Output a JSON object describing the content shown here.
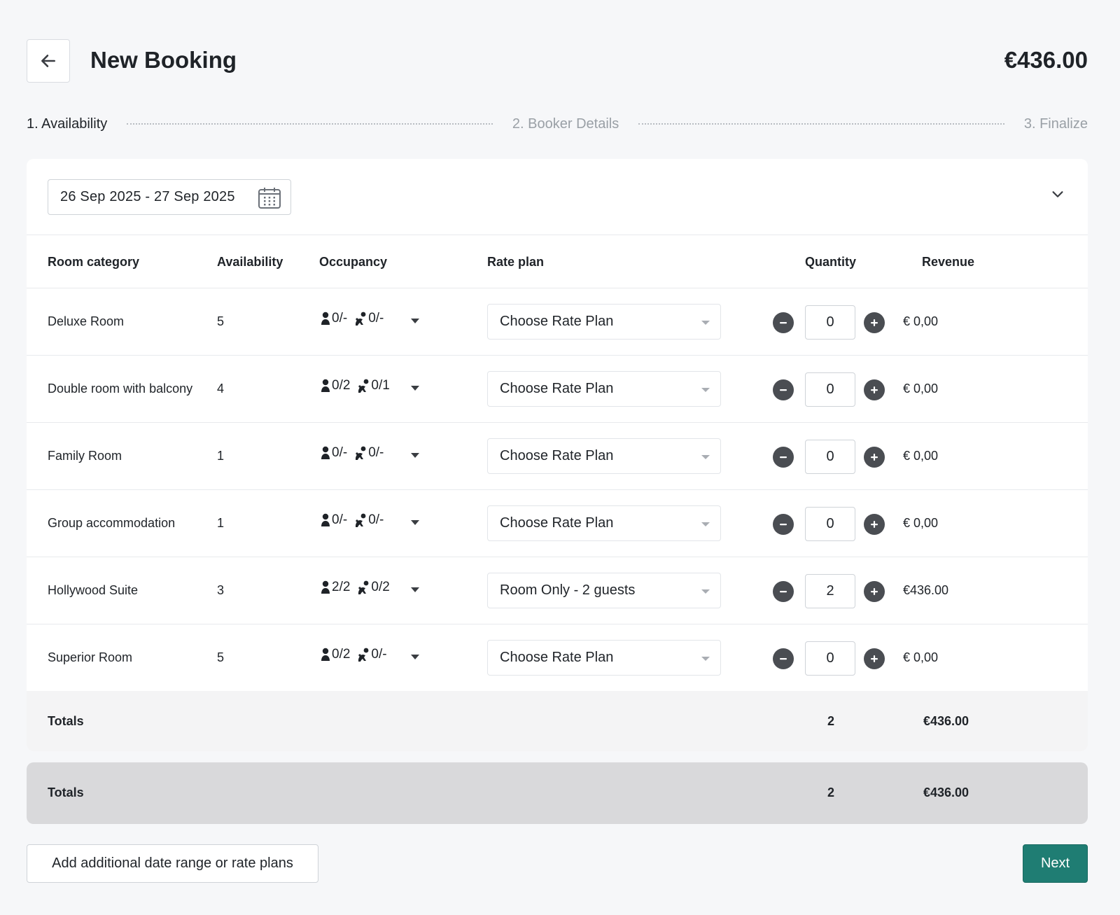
{
  "header": {
    "title": "New Booking",
    "total": "€436.00"
  },
  "stepper": {
    "steps": [
      "1. Availability",
      "2. Booker Details",
      "3. Finalize"
    ],
    "active_step": 1
  },
  "date_range": {
    "value": "26 Sep 2025 - 27 Sep 2025"
  },
  "table": {
    "columns": [
      "Room category",
      "Availability",
      "Occupancy",
      "Rate plan",
      "Quantity",
      "Revenue"
    ],
    "rows": [
      {
        "category": "Deluxe Room",
        "availability": "5",
        "adults": "0/-",
        "children": "0/-",
        "rate_plan": "Choose Rate Plan",
        "quantity": "0",
        "revenue": "€ 0,00"
      },
      {
        "category": "Double room with balcony",
        "availability": "4",
        "adults": "0/2",
        "children": "0/1",
        "rate_plan": "Choose Rate Plan",
        "quantity": "0",
        "revenue": "€ 0,00"
      },
      {
        "category": "Family Room",
        "availability": "1",
        "adults": "0/-",
        "children": "0/-",
        "rate_plan": "Choose Rate Plan",
        "quantity": "0",
        "revenue": "€ 0,00"
      },
      {
        "category": "Group accommodation",
        "availability": "1",
        "adults": "0/-",
        "children": "0/-",
        "rate_plan": "Choose Rate Plan",
        "quantity": "0",
        "revenue": "€ 0,00"
      },
      {
        "category": "Hollywood Suite",
        "availability": "3",
        "adults": "2/2",
        "children": "0/2",
        "rate_plan": "Room Only - 2 guests",
        "quantity": "2",
        "revenue": "€436.00"
      },
      {
        "category": "Superior Room",
        "availability": "5",
        "adults": "0/2",
        "children": "0/-",
        "rate_plan": "Choose Rate Plan",
        "quantity": "0",
        "revenue": "€ 0,00"
      }
    ],
    "totals": {
      "label": "Totals",
      "quantity": "2",
      "revenue": "€436.00"
    }
  },
  "grand_totals": {
    "label": "Totals",
    "quantity": "2",
    "revenue": "€436.00"
  },
  "footer": {
    "add_label": "Add additional date range or rate plans",
    "next_label": "Next"
  },
  "colors": {
    "background": "#f6f7f9",
    "accent": "#1f7d73",
    "inactive_step": "#9aa0a6",
    "grand_totals_bg": "#d9d9db"
  },
  "icons": {
    "back": "arrow-left-icon",
    "calendar": "calendar-icon",
    "collapse": "chevron-down-icon",
    "adult": "person-icon",
    "child": "child-icon",
    "minus": "minus-circle-icon",
    "plus": "plus-circle-icon"
  }
}
